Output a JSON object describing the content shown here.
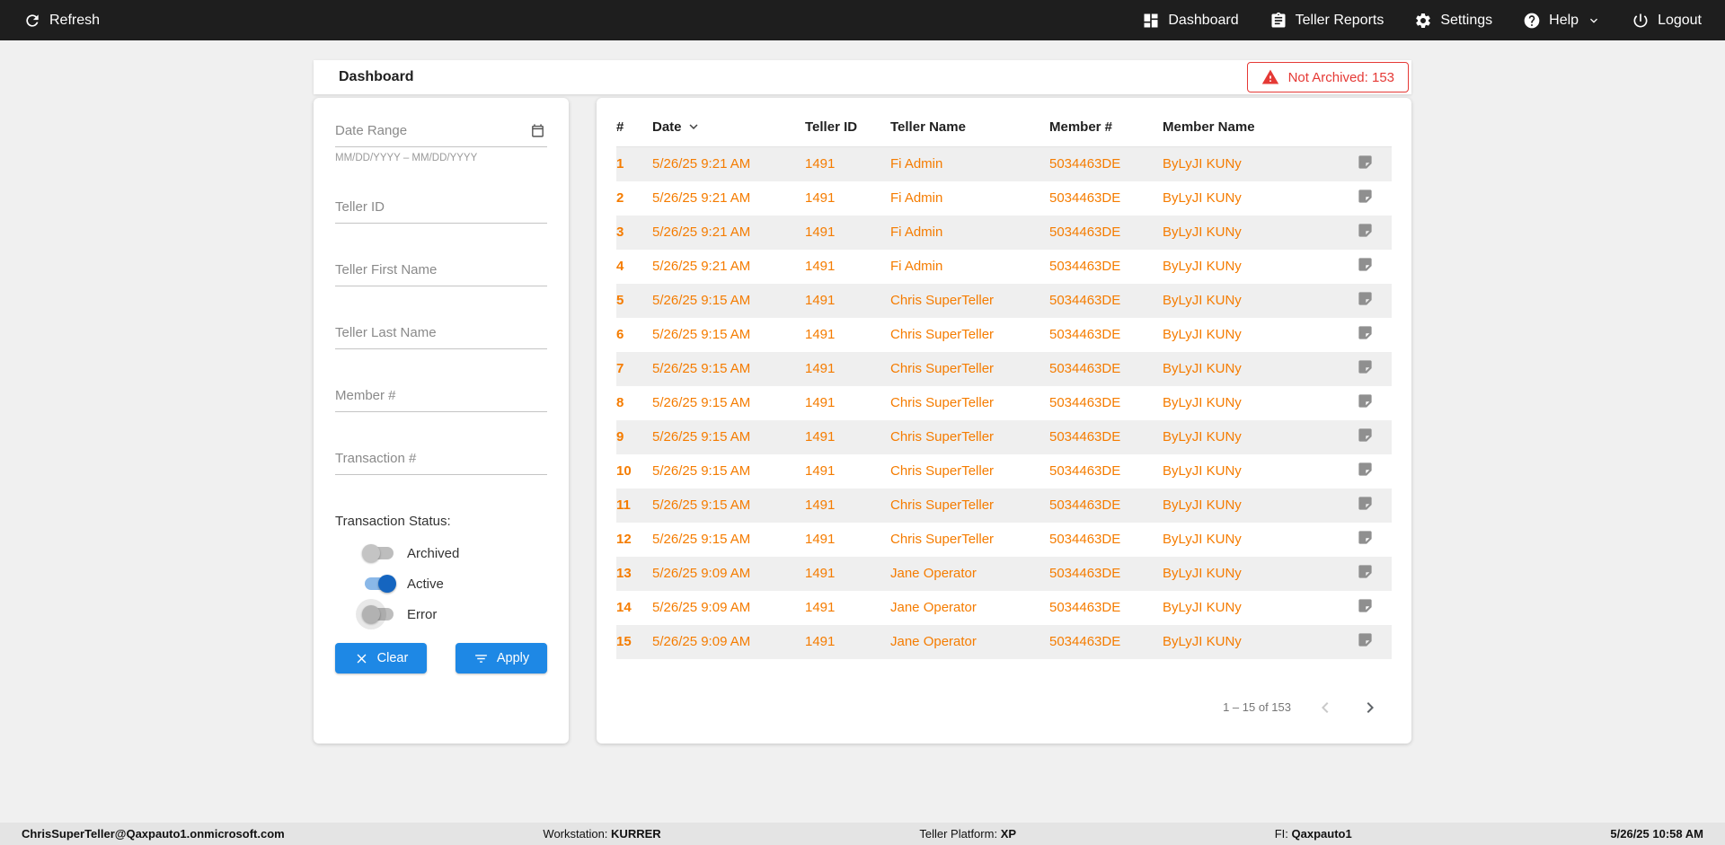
{
  "topbar": {
    "refresh_label": "Refresh",
    "nav": [
      {
        "label": "Dashboard",
        "icon": "dashboard-icon"
      },
      {
        "label": "Teller Reports",
        "icon": "teller-reports-icon"
      },
      {
        "label": "Settings",
        "icon": "settings-icon"
      },
      {
        "label": "Help",
        "icon": "help-icon",
        "has_chevron": true
      },
      {
        "label": "Logout",
        "icon": "logout-icon"
      }
    ]
  },
  "header": {
    "title": "Dashboard",
    "not_archived_badge": "Not Archived: 153"
  },
  "filters": {
    "date_range_placeholder": "Date Range",
    "date_range_hint": "MM/DD/YYYY – MM/DD/YYYY",
    "teller_id_placeholder": "Teller ID",
    "teller_first_name_placeholder": "Teller First Name",
    "teller_last_name_placeholder": "Teller Last Name",
    "member_number_placeholder": "Member #",
    "transaction_number_placeholder": "Transaction #",
    "status_label": "Transaction Status:",
    "toggles": [
      {
        "label": "Archived",
        "on": false
      },
      {
        "label": "Active",
        "on": true
      },
      {
        "label": "Error",
        "on": false
      }
    ],
    "clear_button": "Clear",
    "apply_button": "Apply"
  },
  "table": {
    "columns": [
      "#",
      "Date",
      "Teller ID",
      "Teller Name",
      "Member #",
      "Member Name"
    ],
    "rows": [
      {
        "num": "1",
        "date": "5/26/25 9:21 AM",
        "teller_id": "1491",
        "teller_name": "Fi Admin",
        "member_num": "5034463DE",
        "member_name": "ByLyJI KUNy"
      },
      {
        "num": "2",
        "date": "5/26/25 9:21 AM",
        "teller_id": "1491",
        "teller_name": "Fi Admin",
        "member_num": "5034463DE",
        "member_name": "ByLyJI KUNy"
      },
      {
        "num": "3",
        "date": "5/26/25 9:21 AM",
        "teller_id": "1491",
        "teller_name": "Fi Admin",
        "member_num": "5034463DE",
        "member_name": "ByLyJI KUNy"
      },
      {
        "num": "4",
        "date": "5/26/25 9:21 AM",
        "teller_id": "1491",
        "teller_name": "Fi Admin",
        "member_num": "5034463DE",
        "member_name": "ByLyJI KUNy"
      },
      {
        "num": "5",
        "date": "5/26/25 9:15 AM",
        "teller_id": "1491",
        "teller_name": "Chris SuperTeller",
        "member_num": "5034463DE",
        "member_name": "ByLyJI KUNy"
      },
      {
        "num": "6",
        "date": "5/26/25 9:15 AM",
        "teller_id": "1491",
        "teller_name": "Chris SuperTeller",
        "member_num": "5034463DE",
        "member_name": "ByLyJI KUNy"
      },
      {
        "num": "7",
        "date": "5/26/25 9:15 AM",
        "teller_id": "1491",
        "teller_name": "Chris SuperTeller",
        "member_num": "5034463DE",
        "member_name": "ByLyJI KUNy"
      },
      {
        "num": "8",
        "date": "5/26/25 9:15 AM",
        "teller_id": "1491",
        "teller_name": "Chris SuperTeller",
        "member_num": "5034463DE",
        "member_name": "ByLyJI KUNy"
      },
      {
        "num": "9",
        "date": "5/26/25 9:15 AM",
        "teller_id": "1491",
        "teller_name": "Chris SuperTeller",
        "member_num": "5034463DE",
        "member_name": "ByLyJI KUNy"
      },
      {
        "num": "10",
        "date": "5/26/25 9:15 AM",
        "teller_id": "1491",
        "teller_name": "Chris SuperTeller",
        "member_num": "5034463DE",
        "member_name": "ByLyJI KUNy"
      },
      {
        "num": "11",
        "date": "5/26/25 9:15 AM",
        "teller_id": "1491",
        "teller_name": "Chris SuperTeller",
        "member_num": "5034463DE",
        "member_name": "ByLyJI KUNy"
      },
      {
        "num": "12",
        "date": "5/26/25 9:15 AM",
        "teller_id": "1491",
        "teller_name": "Chris SuperTeller",
        "member_num": "5034463DE",
        "member_name": "ByLyJI KUNy"
      },
      {
        "num": "13",
        "date": "5/26/25 9:09 AM",
        "teller_id": "1491",
        "teller_name": "Jane Operator",
        "member_num": "5034463DE",
        "member_name": "ByLyJI KUNy"
      },
      {
        "num": "14",
        "date": "5/26/25 9:09 AM",
        "teller_id": "1491",
        "teller_name": "Jane Operator",
        "member_num": "5034463DE",
        "member_name": "ByLyJI KUNy"
      },
      {
        "num": "15",
        "date": "5/26/25 9:09 AM",
        "teller_id": "1491",
        "teller_name": "Jane Operator",
        "member_num": "5034463DE",
        "member_name": "ByLyJI KUNy"
      }
    ],
    "pagination": {
      "range_text": "1 – 15 of 153"
    }
  },
  "footer": {
    "user": "ChrisSuperTeller@Qaxpauto1.onmicrosoft.com",
    "workstation_label": "Workstation:",
    "workstation_value": "KURRER",
    "platform_label": "Teller Platform:",
    "platform_value": "XP",
    "fi_label": "FI:",
    "fi_value": "Qaxpauto1",
    "datetime": "5/26/25 10:58 AM"
  },
  "colors": {
    "topbar_bg": "#1e1e1e",
    "accent_orange": "#f57c00",
    "button_blue": "#1e88e5",
    "toggle_on_blue": "#1565c0",
    "alert_red": "#e53935",
    "row_stripe": "#efefef",
    "page_bg": "#f0f0f0"
  }
}
